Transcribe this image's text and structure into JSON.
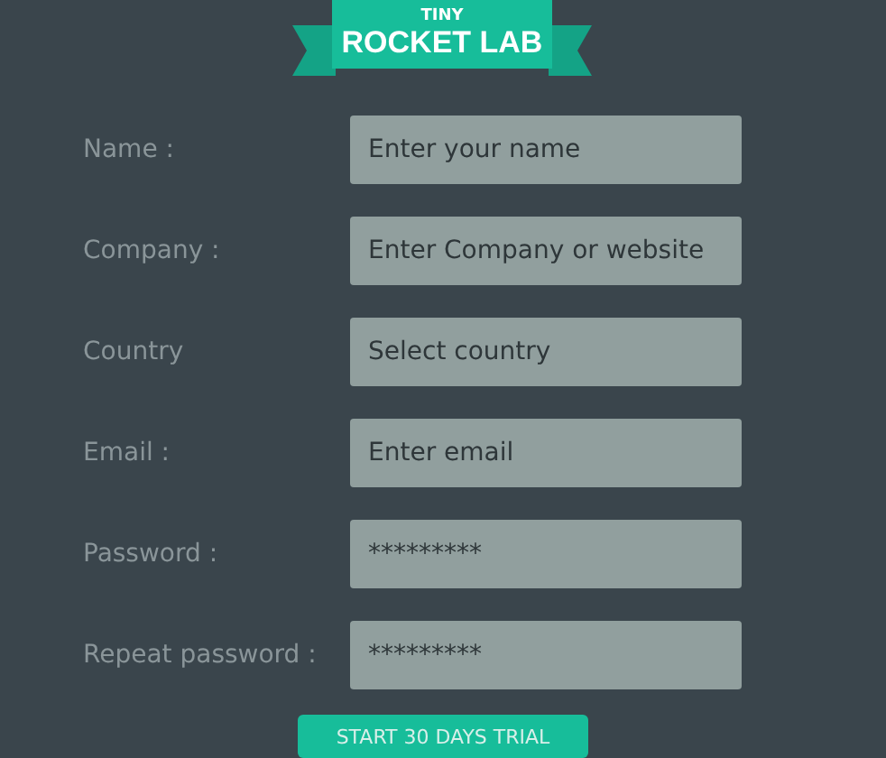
{
  "logo": {
    "small": "TINY",
    "large": "ROCKET LAB"
  },
  "fields": [
    {
      "label": "Name :",
      "kind": "text",
      "placeholder": "Enter your name"
    },
    {
      "label": "Company :",
      "kind": "text",
      "placeholder": "Enter Company or website"
    },
    {
      "label": "Country",
      "kind": "select",
      "placeholder": "Select country"
    },
    {
      "label": "Email :",
      "kind": "text",
      "placeholder": "Enter email"
    },
    {
      "label": "Password :",
      "kind": "password",
      "value": "*********"
    },
    {
      "label": "Repeat password :",
      "kind": "password",
      "value": "*********"
    }
  ],
  "submit": "START 30 DAYS TRIAL"
}
